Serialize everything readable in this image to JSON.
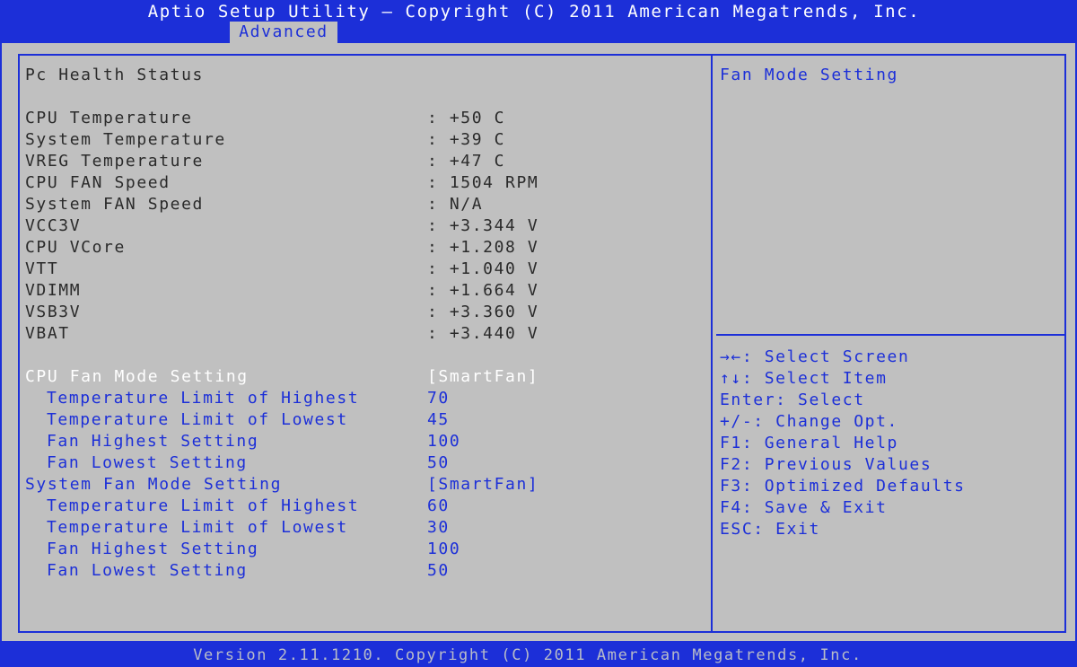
{
  "header": {
    "title": "Aptio Setup Utility – Copyright (C) 2011 American Megatrends, Inc.",
    "active_tab": "Advanced"
  },
  "section_title": "Pc Health Status",
  "readings": [
    {
      "label": "CPU Temperature",
      "value": ": +50 C"
    },
    {
      "label": "System Temperature",
      "value": ": +39 C"
    },
    {
      "label": "VREG Temperature",
      "value": ": +47 C"
    },
    {
      "label": "CPU FAN Speed",
      "value": ": 1504 RPM"
    },
    {
      "label": "System FAN Speed",
      "value": ": N/A"
    },
    {
      "label": "VCC3V",
      "value": ": +3.344 V"
    },
    {
      "label": "CPU VCore",
      "value": ": +1.208 V"
    },
    {
      "label": "VTT",
      "value": ": +1.040 V"
    },
    {
      "label": "VDIMM",
      "value": ": +1.664 V"
    },
    {
      "label": "VSB3V",
      "value": ": +3.360 V"
    },
    {
      "label": "VBAT",
      "value": ": +3.440 V"
    }
  ],
  "settings": [
    {
      "label": "CPU Fan Mode Setting",
      "value": "[SmartFan]"
    },
    {
      "label": "Temperature Limit of Highest",
      "value": "70"
    },
    {
      "label": "Temperature Limit of Lowest",
      "value": "45"
    },
    {
      "label": "Fan Highest Setting",
      "value": "100"
    },
    {
      "label": "Fan Lowest Setting",
      "value": "50"
    },
    {
      "label": "System Fan Mode Setting",
      "value": "[SmartFan]"
    },
    {
      "label": "Temperature Limit of Highest",
      "value": "60"
    },
    {
      "label": "Temperature Limit of Lowest",
      "value": "30"
    },
    {
      "label": "Fan Highest Setting",
      "value": "100"
    },
    {
      "label": "Fan Lowest Setting",
      "value": "50"
    }
  ],
  "help": {
    "description": "Fan Mode Setting",
    "keys": [
      "→←: Select Screen",
      "↑↓: Select Item",
      "Enter: Select",
      "+/-: Change Opt.",
      "F1: General Help",
      "F2: Previous Values",
      "F3: Optimized Defaults",
      "F4: Save & Exit",
      "ESC: Exit"
    ]
  },
  "footer": {
    "version": "Version 2.11.1210. Copyright (C) 2011 American Megatrends, Inc."
  },
  "colors": {
    "bios_blue": "#1c2fd8",
    "panel_gray": "#c0c0c0",
    "text_dark": "#2a2a2a",
    "selected_text": "#ffffff"
  }
}
